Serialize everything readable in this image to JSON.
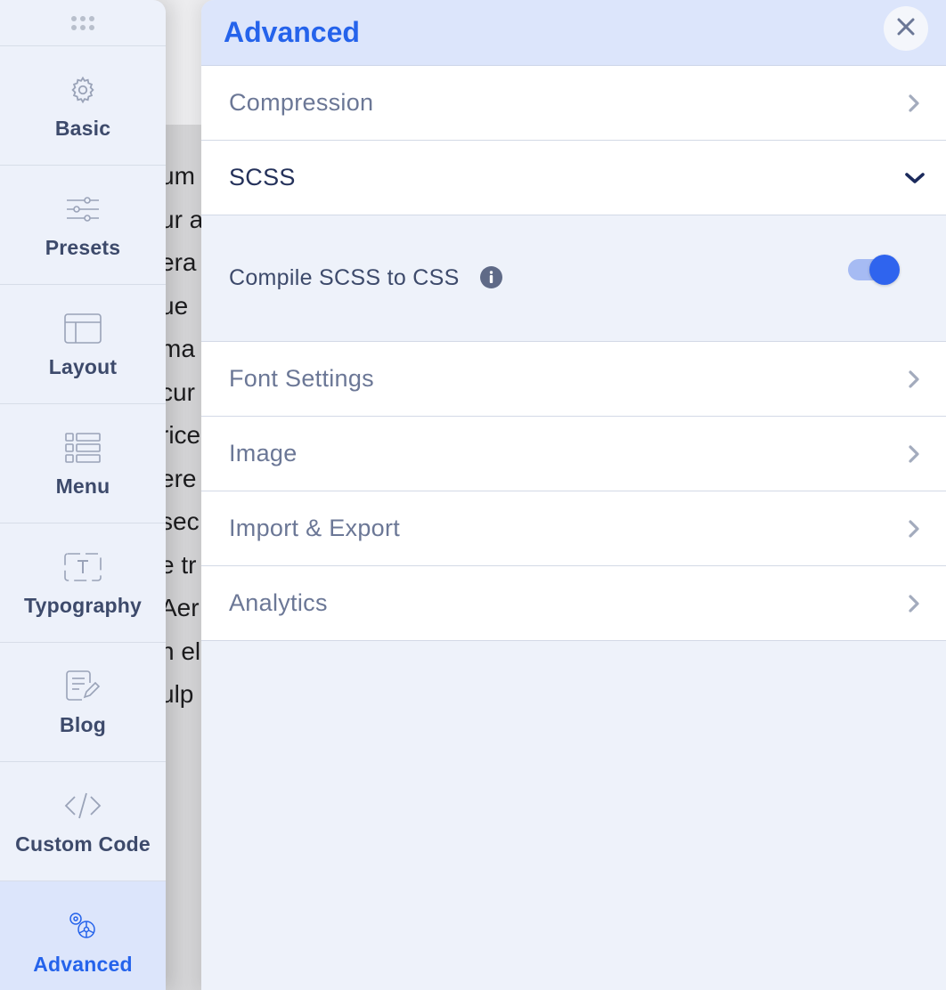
{
  "background_text": [
    "um",
    "ur a",
    "era",
    "ue",
    " ma",
    "cur",
    "rice",
    "ere",
    "sec",
    "e tr",
    "Aer",
    "n el",
    "ulp"
  ],
  "sidebar": {
    "items": [
      {
        "label": "Basic",
        "icon": "gear-icon"
      },
      {
        "label": "Presets",
        "icon": "sliders-icon"
      },
      {
        "label": "Layout",
        "icon": "layout-icon"
      },
      {
        "label": "Menu",
        "icon": "menu-list-icon"
      },
      {
        "label": "Typography",
        "icon": "typography-icon"
      },
      {
        "label": "Blog",
        "icon": "blog-edit-icon"
      },
      {
        "label": "Custom Code",
        "icon": "code-icon"
      },
      {
        "label": "Advanced",
        "icon": "advanced-gears-icon",
        "active": true
      }
    ]
  },
  "panel": {
    "title": "Advanced",
    "sections": [
      {
        "label": "Compression",
        "expanded": false
      },
      {
        "label": "SCSS",
        "expanded": true
      },
      {
        "label": "Font Settings",
        "expanded": false
      },
      {
        "label": "Image",
        "expanded": false
      },
      {
        "label": "Import & Export",
        "expanded": false
      },
      {
        "label": "Analytics",
        "expanded": false
      }
    ],
    "scss": {
      "compile_label": "Compile SCSS to CSS",
      "compile_enabled": true
    }
  },
  "colors": {
    "accent": "#2563eb",
    "sidebar_bg": "#edf1fa",
    "active_bg": "#dce5fb",
    "text_muted": "#6b7796",
    "text_dark": "#24315a"
  }
}
